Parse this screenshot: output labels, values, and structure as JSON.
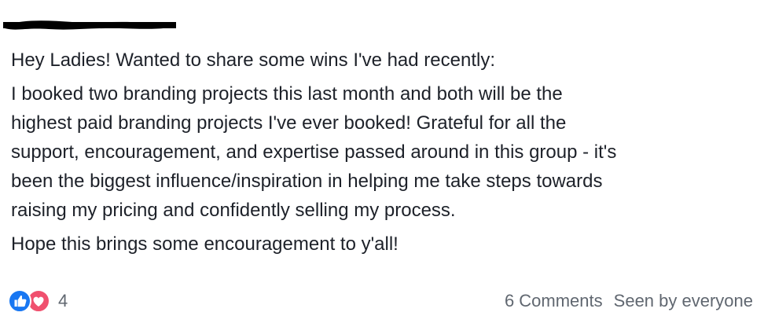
{
  "post": {
    "greeting": "Hey Ladies! Wanted to share some wins I've had recently:",
    "body_lines": [
      "I booked two branding projects this last month and both will be the",
      "highest paid branding projects I've ever booked! Grateful for all the",
      "support, encouragement, and expertise passed around in this group - it's",
      "been the biggest influence/inspiration in helping me take steps towards",
      "raising my pricing and confidently selling my process."
    ],
    "closing": "Hope this brings some encouragement to y'all!"
  },
  "footer": {
    "reaction_icons": [
      "like-icon",
      "love-icon"
    ],
    "reaction_count": "4",
    "comments_label": "6 Comments",
    "seen_label": "Seen by everyone"
  },
  "colors": {
    "like_blue": "#1877f2",
    "love_red": "#f0506e",
    "meta_gray": "#606770",
    "text": "#1d2129"
  }
}
